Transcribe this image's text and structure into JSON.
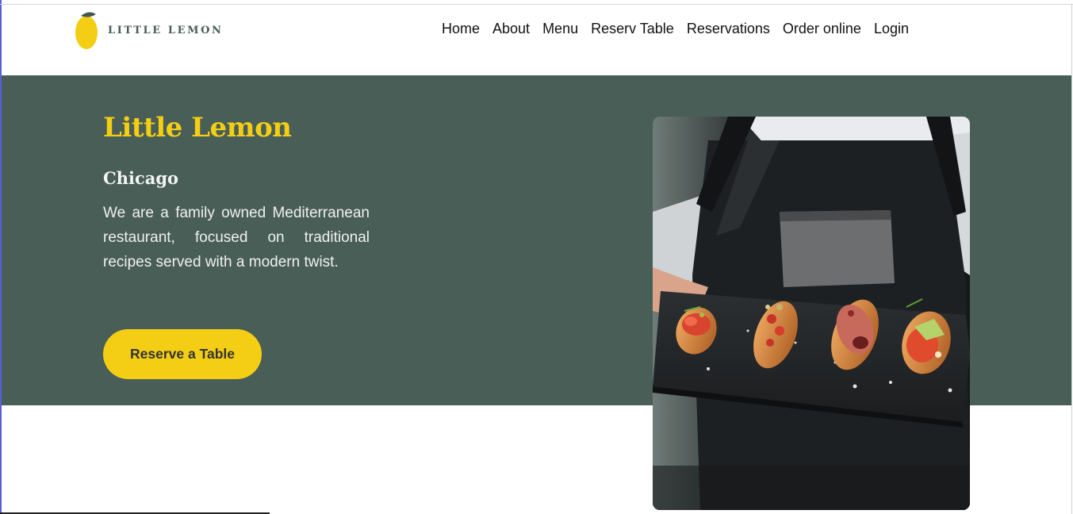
{
  "header": {
    "logo_text": "LITTLE LEMON",
    "logo_icon": "lemon-icon",
    "nav": [
      {
        "label": "Home"
      },
      {
        "label": "About"
      },
      {
        "label": "Menu"
      },
      {
        "label": "Reserv Table"
      },
      {
        "label": "Reservations"
      },
      {
        "label": "Order online"
      },
      {
        "label": "Login"
      }
    ]
  },
  "hero": {
    "title": "Little Lemon",
    "city": "Chicago",
    "description": "We are a family owned Mediterranean restaurant, focused on traditional recipes served with a modern twist.",
    "cta_label": "Reserve a Table",
    "image_subject": "food-platter-photo"
  },
  "colors": {
    "primary_green": "#495e57",
    "primary_yellow": "#f4ce14",
    "white": "#ffffff"
  }
}
